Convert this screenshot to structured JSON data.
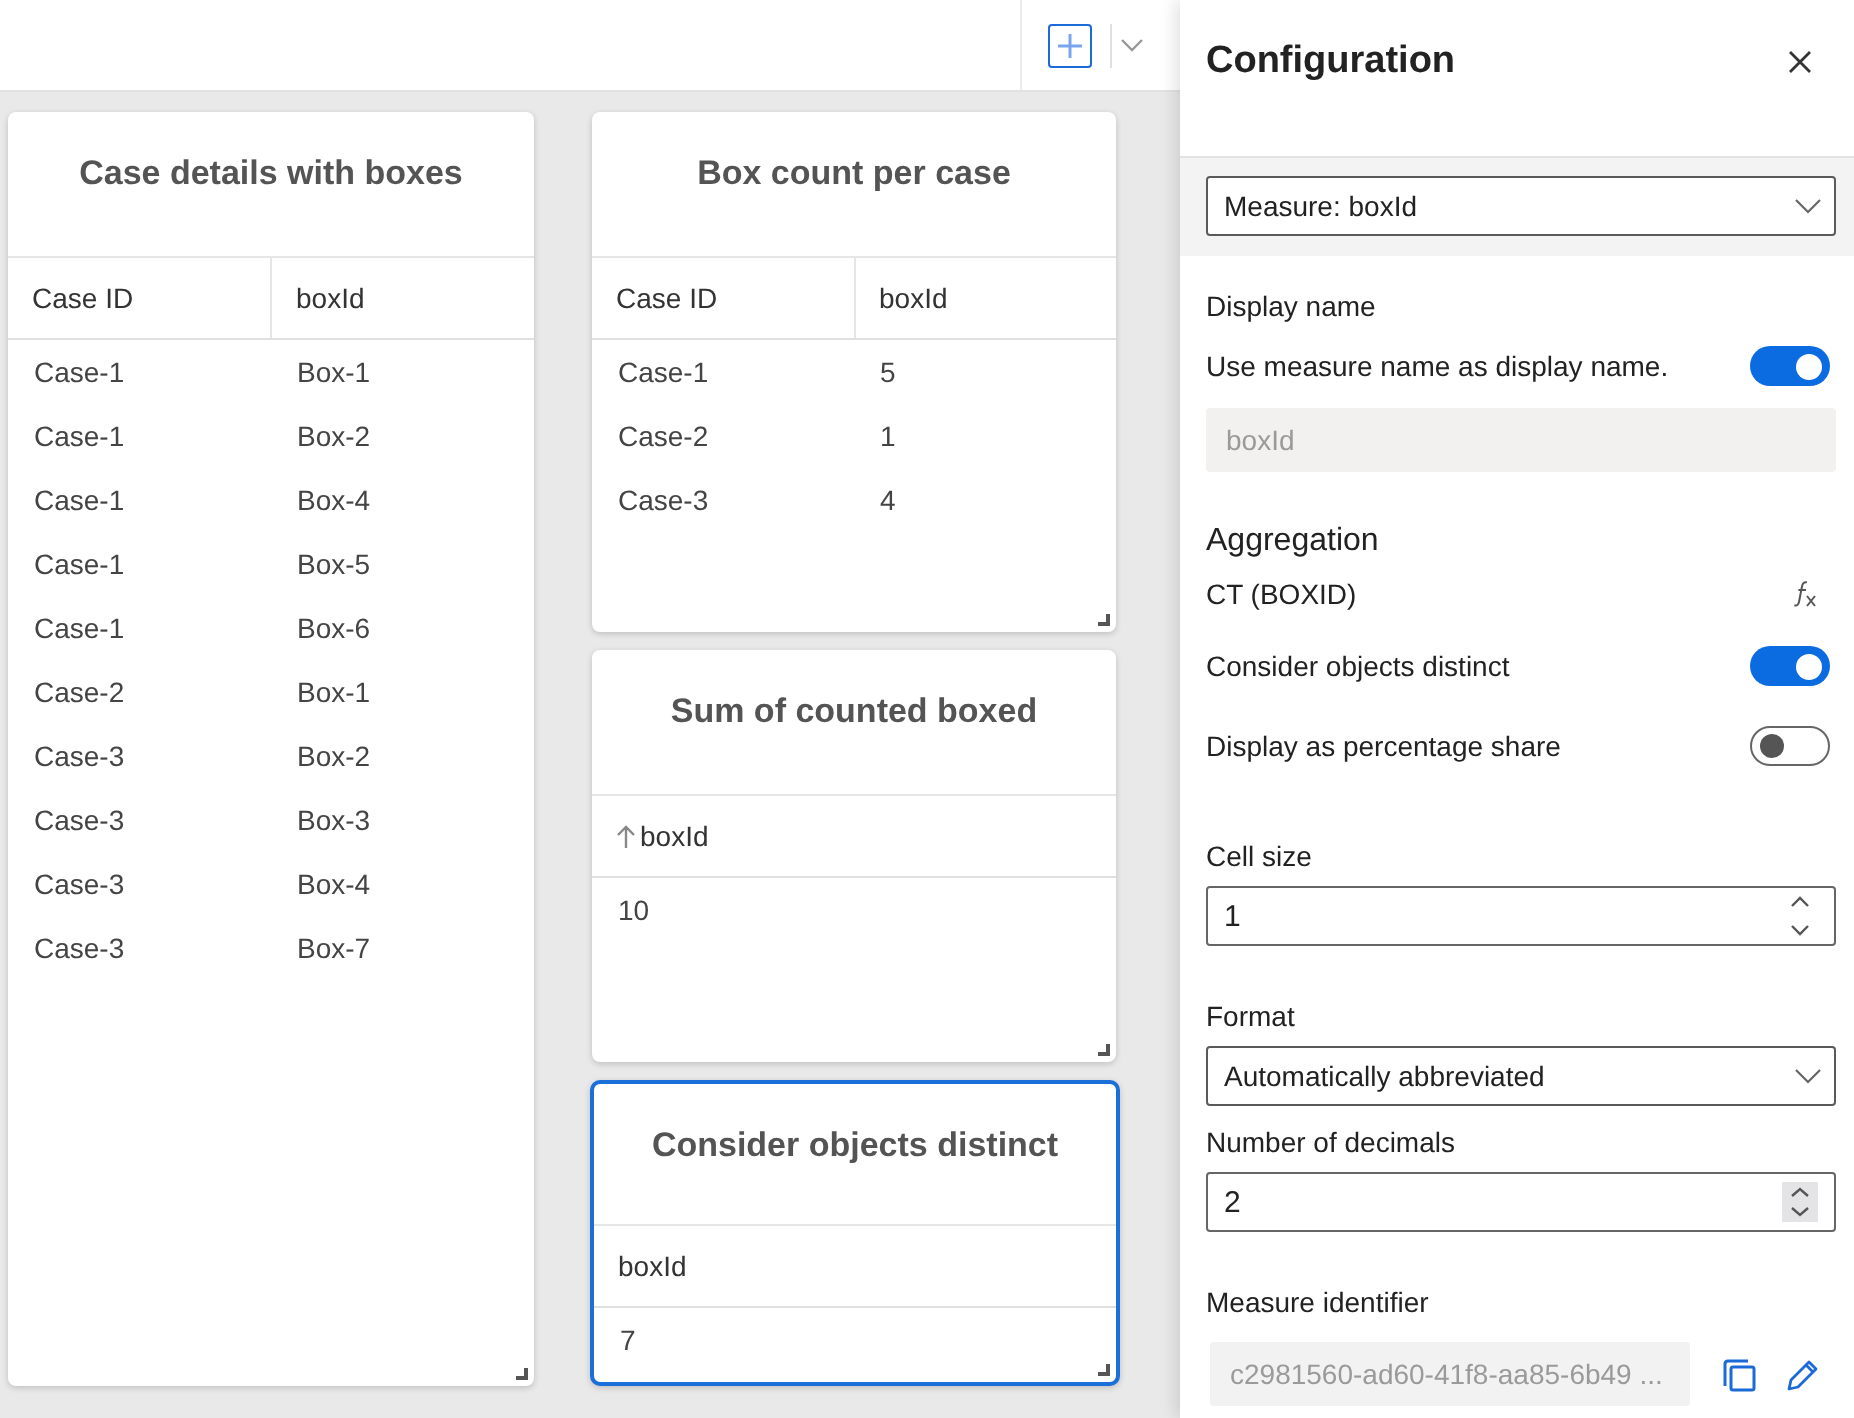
{
  "cards": [
    {
      "title": "Case details with boxes",
      "selected": false,
      "columns": [
        {
          "label": "Case ID",
          "sorted_ascending": false
        },
        {
          "label": "boxId",
          "sorted_ascending": false
        }
      ],
      "rows": [
        [
          "Case-1",
          "Box-1"
        ],
        [
          "Case-1",
          "Box-2"
        ],
        [
          "Case-1",
          "Box-4"
        ],
        [
          "Case-1",
          "Box-5"
        ],
        [
          "Case-1",
          "Box-6"
        ],
        [
          "Case-2",
          "Box-1"
        ],
        [
          "Case-3",
          "Box-2"
        ],
        [
          "Case-3",
          "Box-3"
        ],
        [
          "Case-3",
          "Box-4"
        ],
        [
          "Case-3",
          "Box-7"
        ]
      ]
    },
    {
      "title": "Box count per case",
      "selected": false,
      "columns": [
        {
          "label": "Case ID",
          "sorted_ascending": false
        },
        {
          "label": "boxId",
          "sorted_ascending": false
        }
      ],
      "rows": [
        [
          "Case-1",
          "5"
        ],
        [
          "Case-2",
          "1"
        ],
        [
          "Case-3",
          "4"
        ]
      ]
    },
    {
      "title": "Sum of counted boxed",
      "selected": false,
      "columns": [
        {
          "label": "boxId",
          "sorted_ascending": true
        }
      ],
      "rows": [
        [
          "10"
        ]
      ]
    },
    {
      "title": "Consider objects distinct",
      "selected": true,
      "columns": [
        {
          "label": "boxId",
          "sorted_ascending": false
        }
      ],
      "rows": [
        [
          "7"
        ]
      ]
    }
  ],
  "panel": {
    "title": "Configuration",
    "measure_select": {
      "value": "Measure: boxId"
    },
    "sections": [
      {
        "items": [
          {
            "kind": "label",
            "text": "Display name"
          },
          {
            "kind": "toggle",
            "label": "Use measure name as display name.",
            "on": true
          },
          {
            "kind": "text_field",
            "value": "boxId",
            "disabled": true
          }
        ]
      },
      {
        "items": [
          {
            "kind": "heading",
            "text": "Aggregation"
          },
          {
            "kind": "formula",
            "text": "CT (BOXID)"
          },
          {
            "kind": "toggle",
            "label": "Consider objects distinct",
            "on": true
          },
          {
            "kind": "toggle",
            "label": "Display as percentage share",
            "on": false
          }
        ]
      },
      {
        "items": [
          {
            "kind": "label",
            "text": "Cell size"
          },
          {
            "kind": "number_field",
            "value": "1",
            "hovered": false
          }
        ]
      },
      {
        "items": [
          {
            "kind": "label",
            "text": "Format"
          },
          {
            "kind": "select",
            "value": "Automatically abbreviated"
          },
          {
            "kind": "label",
            "text": "Number of decimals"
          },
          {
            "kind": "number_field",
            "value": "2",
            "hovered": true
          }
        ]
      },
      {
        "items": [
          {
            "kind": "label",
            "text": "Measure identifier"
          },
          {
            "kind": "identifier",
            "value": "c2981560-ad60-41f8-aa85-6b49 ...",
            "disabled": true
          }
        ]
      }
    ]
  }
}
